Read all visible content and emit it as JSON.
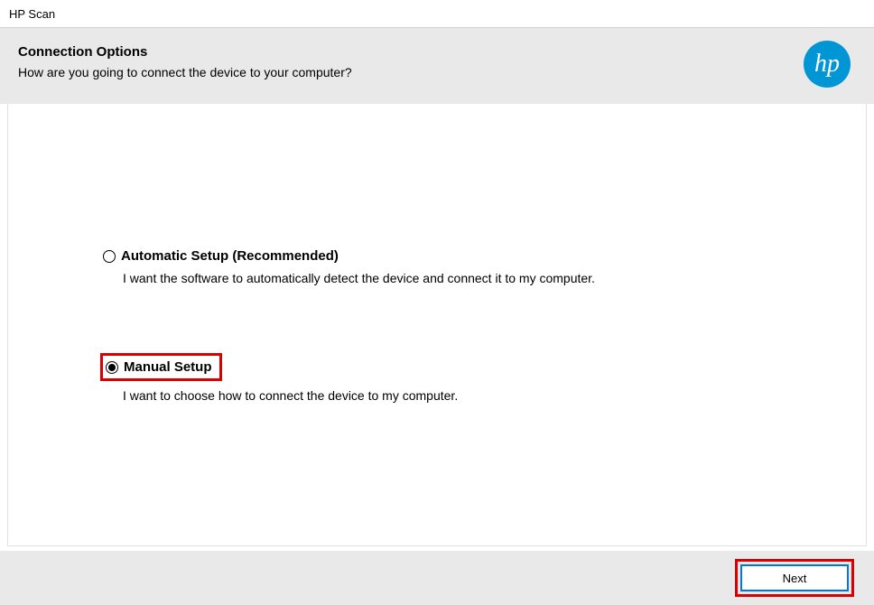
{
  "window": {
    "title": "HP Scan"
  },
  "header": {
    "title": "Connection Options",
    "subtitle": "How are you going to connect the device to your computer?",
    "logo_text": "hp"
  },
  "options": [
    {
      "label": "Automatic Setup (Recommended)",
      "description": "I want the software to automatically detect the device and connect it to my computer.",
      "selected": false,
      "highlighted": false
    },
    {
      "label": "Manual Setup",
      "description": "I want to choose how to connect the device to my computer.",
      "selected": true,
      "highlighted": true
    }
  ],
  "footer": {
    "next_label": "Next"
  }
}
